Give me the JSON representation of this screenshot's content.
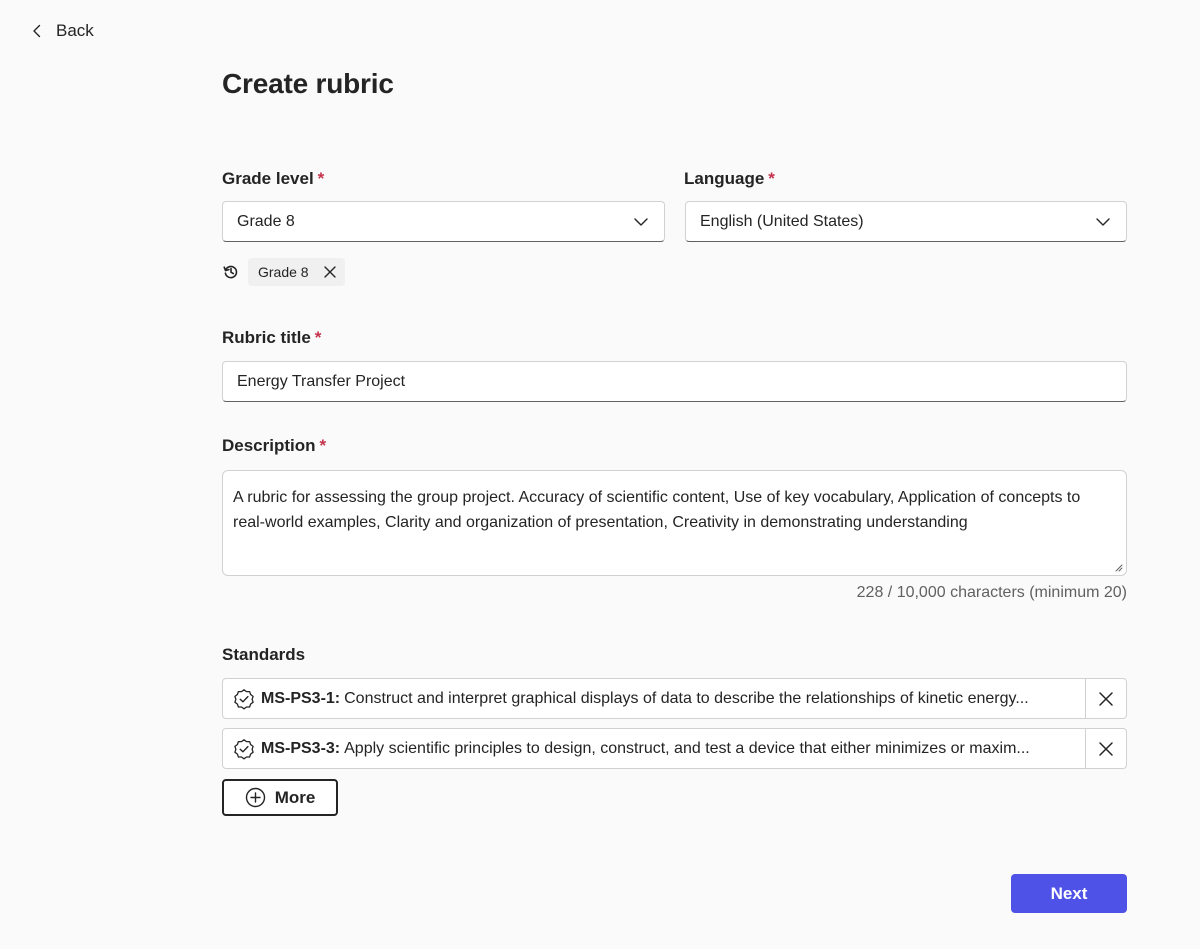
{
  "nav": {
    "back_label": "Back"
  },
  "page": {
    "title": "Create rubric"
  },
  "form": {
    "grade_level": {
      "label": "Grade level",
      "required_mark": "*",
      "value": "Grade 8",
      "history_chip": "Grade 8"
    },
    "language": {
      "label": "Language",
      "required_mark": "*",
      "value": "English (United States)"
    },
    "rubric_title": {
      "label": "Rubric title",
      "required_mark": "*",
      "value": "Energy Transfer Project"
    },
    "description": {
      "label": "Description",
      "required_mark": "*",
      "value": "A rubric for assessing the group project. Accuracy of scientific content, Use of key vocabulary, Application of concepts to real-world examples, Clarity and organization of presentation, Creativity in demonstrating understanding",
      "char_count": "228 / 10,000 characters (minimum 20)"
    },
    "standards": {
      "label": "Standards",
      "items": [
        {
          "code": "MS-PS3-1:",
          "text": "Construct and interpret graphical displays of data to describe the relationships of kinetic energy..."
        },
        {
          "code": "MS-PS3-3:",
          "text": "Apply scientific principles to design, construct, and test a device that either minimizes or maxim..."
        }
      ],
      "more_label": "More"
    }
  },
  "footer": {
    "next_label": "Next"
  },
  "icons": {
    "back": "chevron-left-icon",
    "dropdown": "chevron-down-icon",
    "history": "history-icon",
    "dismiss": "close-icon",
    "standard": "verified-badge-icon",
    "add": "add-circle-icon"
  },
  "colors": {
    "accent": "#4f52e6",
    "required": "#c4314b",
    "background": "#fafafa"
  }
}
